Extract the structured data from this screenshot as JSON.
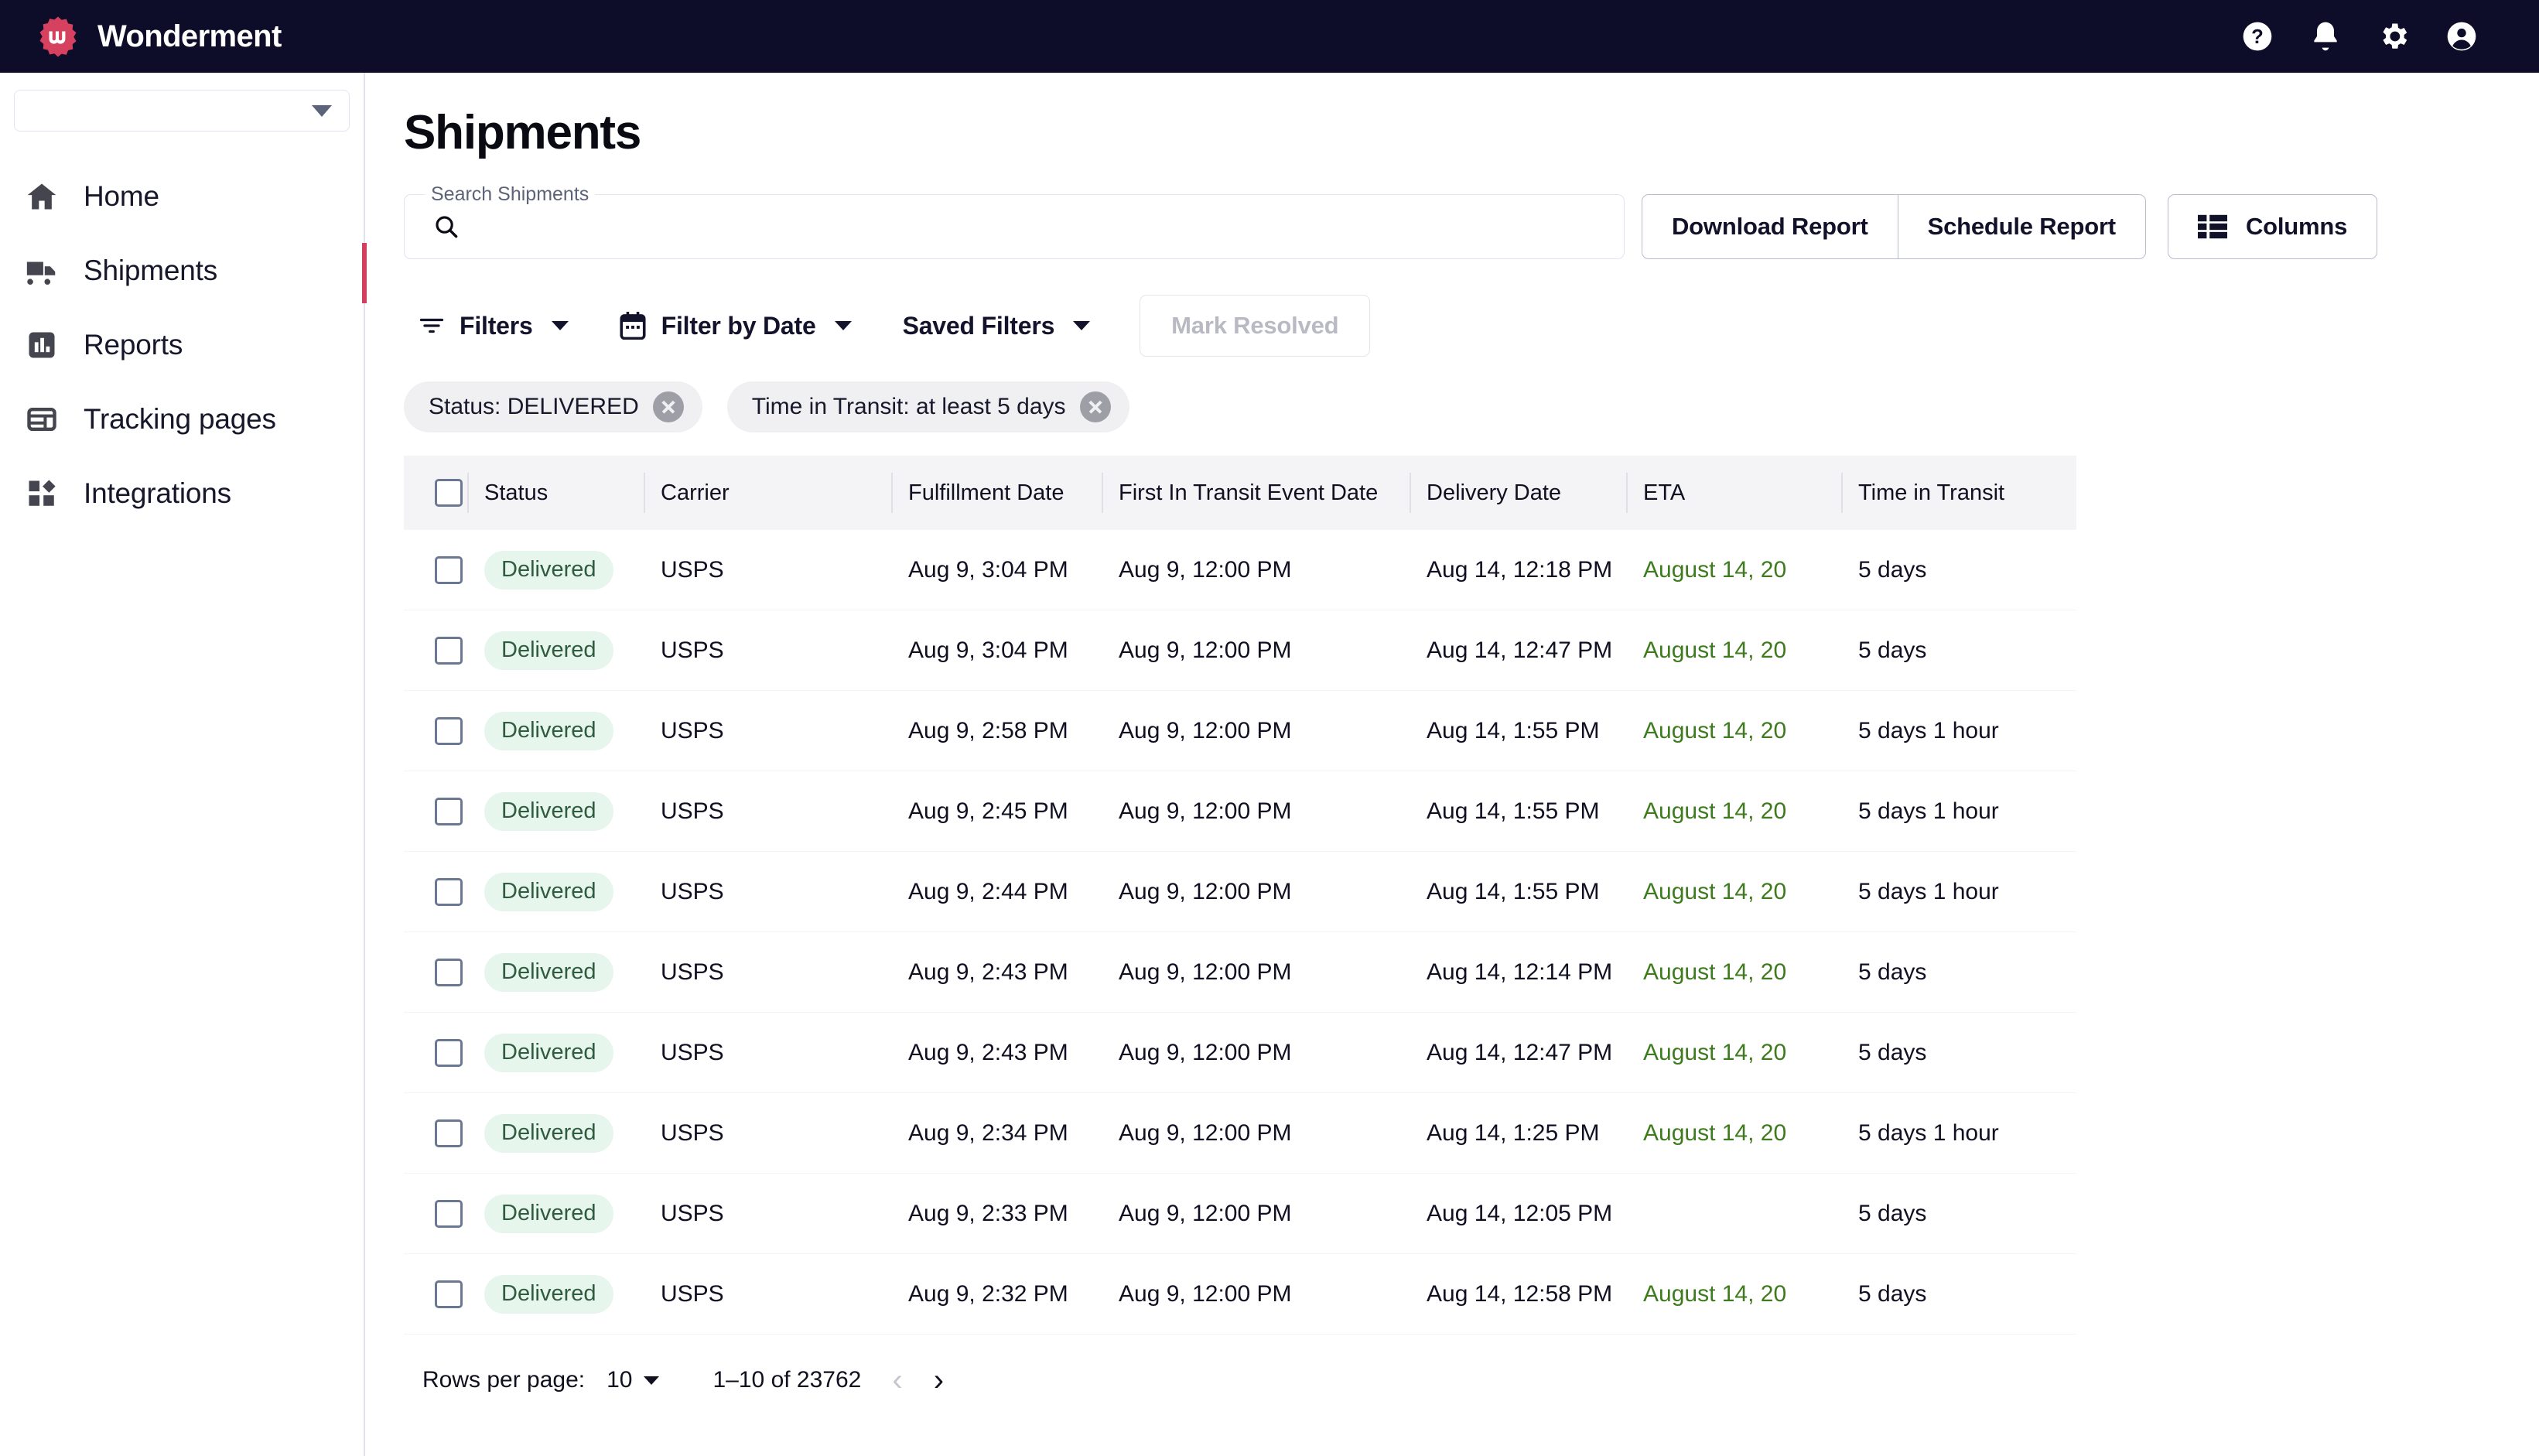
{
  "topbar": {
    "brand": "Wonderment",
    "icons": [
      {
        "name": "help-icon"
      },
      {
        "name": "notifications-bell-icon"
      },
      {
        "name": "settings-gear-icon"
      },
      {
        "name": "account-avatar-icon"
      }
    ]
  },
  "sidebar": {
    "org_selector": {
      "value": "",
      "icon": "chevron-down-icon"
    },
    "items": [
      {
        "label": "Home",
        "icon": "home-icon",
        "active": false
      },
      {
        "label": "Shipments",
        "icon": "truck-icon",
        "active": true
      },
      {
        "label": "Reports",
        "icon": "bar-chart-icon",
        "active": false
      },
      {
        "label": "Tracking pages",
        "icon": "layout-icon",
        "active": false
      },
      {
        "label": "Integrations",
        "icon": "blocks-icon",
        "active": false
      }
    ]
  },
  "page": {
    "title": "Shipments"
  },
  "search": {
    "legend": "Search Shipments",
    "value": "",
    "placeholder": "",
    "icon": "search-icon"
  },
  "actions": {
    "download_report": "Download Report",
    "schedule_report": "Schedule Report",
    "columns": "Columns",
    "columns_icon": "columns-list-icon"
  },
  "toolbar": {
    "filters": "Filters",
    "filters_icon": "filter-lines-icon",
    "filter_by_date": "Filter by Date",
    "filter_by_date_icon": "calendar-icon",
    "saved_filters": "Saved Filters",
    "mark_resolved": "Mark Resolved"
  },
  "chips": [
    {
      "label": "Status: DELIVERED"
    },
    {
      "label": "Time in Transit: at least 5 days"
    }
  ],
  "table": {
    "columns": [
      "Status",
      "Carrier",
      "Fulfillment Date",
      "First In Transit Event Date",
      "Delivery Date",
      "ETA",
      "Time in Transit"
    ],
    "rows": [
      {
        "status": "Delivered",
        "carrier": "USPS",
        "fulfillment": "Aug 9, 3:04 PM",
        "first_in_transit": "Aug 9, 12:00 PM",
        "delivery": "Aug 14, 12:18 PM",
        "eta": "August 14, 20",
        "transit": "5 days"
      },
      {
        "status": "Delivered",
        "carrier": "USPS",
        "fulfillment": "Aug 9, 3:04 PM",
        "first_in_transit": "Aug 9, 12:00 PM",
        "delivery": "Aug 14, 12:47 PM",
        "eta": "August 14, 20",
        "transit": "5 days"
      },
      {
        "status": "Delivered",
        "carrier": "USPS",
        "fulfillment": "Aug 9, 2:58 PM",
        "first_in_transit": "Aug 9, 12:00 PM",
        "delivery": "Aug 14, 1:55 PM",
        "eta": "August 14, 20",
        "transit": "5 days 1 hour"
      },
      {
        "status": "Delivered",
        "carrier": "USPS",
        "fulfillment": "Aug 9, 2:45 PM",
        "first_in_transit": "Aug 9, 12:00 PM",
        "delivery": "Aug 14, 1:55 PM",
        "eta": "August 14, 20",
        "transit": "5 days 1 hour"
      },
      {
        "status": "Delivered",
        "carrier": "USPS",
        "fulfillment": "Aug 9, 2:44 PM",
        "first_in_transit": "Aug 9, 12:00 PM",
        "delivery": "Aug 14, 1:55 PM",
        "eta": "August 14, 20",
        "transit": "5 days 1 hour"
      },
      {
        "status": "Delivered",
        "carrier": "USPS",
        "fulfillment": "Aug 9, 2:43 PM",
        "first_in_transit": "Aug 9, 12:00 PM",
        "delivery": "Aug 14, 12:14 PM",
        "eta": "August 14, 20",
        "transit": "5 days"
      },
      {
        "status": "Delivered",
        "carrier": "USPS",
        "fulfillment": "Aug 9, 2:43 PM",
        "first_in_transit": "Aug 9, 12:00 PM",
        "delivery": "Aug 14, 12:47 PM",
        "eta": "August 14, 20",
        "transit": "5 days"
      },
      {
        "status": "Delivered",
        "carrier": "USPS",
        "fulfillment": "Aug 9, 2:34 PM",
        "first_in_transit": "Aug 9, 12:00 PM",
        "delivery": "Aug 14, 1:25 PM",
        "eta": "August 14, 20",
        "transit": "5 days 1 hour"
      },
      {
        "status": "Delivered",
        "carrier": "USPS",
        "fulfillment": "Aug 9, 2:33 PM",
        "first_in_transit": "Aug 9, 12:00 PM",
        "delivery": "Aug 14, 12:05 PM",
        "eta": "",
        "transit": "5 days"
      },
      {
        "status": "Delivered",
        "carrier": "USPS",
        "fulfillment": "Aug 9, 2:32 PM",
        "first_in_transit": "Aug 9, 12:00 PM",
        "delivery": "Aug 14, 12:58 PM",
        "eta": "August 14, 20",
        "transit": "5 days"
      }
    ]
  },
  "pagination": {
    "rows_per_page_label": "Rows per page:",
    "rows_per_page_value": "10",
    "range": "1–10 of 23762",
    "prev_icon": "chevron-left-icon",
    "next_icon": "chevron-right-icon"
  },
  "colors": {
    "topbar_bg": "#0d0c29",
    "brand_accent": "#d6415f",
    "active_indicator": "#d33f5e",
    "badge_bg": "#e7f6ec",
    "badge_text": "#2f5b3f",
    "eta_text": "#3e7a1e",
    "table_header_bg": "#f4f4f6",
    "chip_bg": "#f0f0f2"
  }
}
